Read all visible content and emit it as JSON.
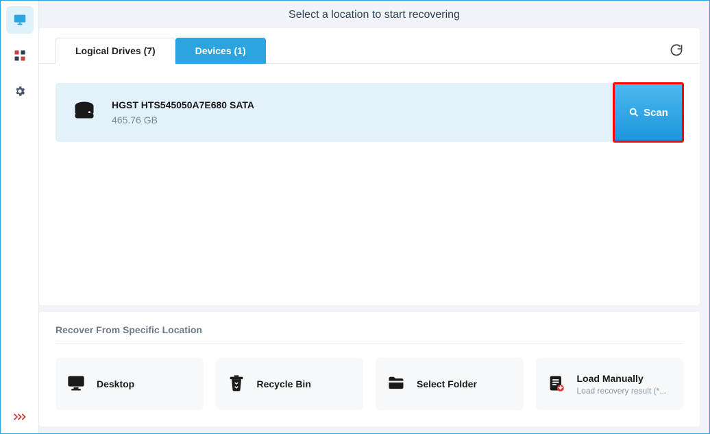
{
  "header": {
    "title": "Select a location to start recovering"
  },
  "tabs": {
    "logical": "Logical Drives (7)",
    "devices": "Devices (1)"
  },
  "device": {
    "name": "HGST HTS545050A7E680 SATA",
    "size": "465.76 GB",
    "scan_label": "Scan"
  },
  "specific": {
    "heading": "Recover From Specific Location",
    "tiles": {
      "desktop": "Desktop",
      "recycle": "Recycle Bin",
      "folder": "Select Folder",
      "load_title": "Load Manually",
      "load_sub": "Load recovery result (*..."
    }
  }
}
